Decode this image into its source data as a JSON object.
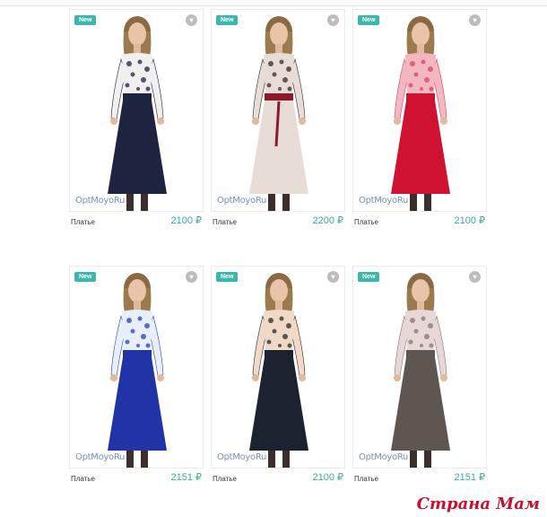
{
  "products": [
    {
      "badge": "New",
      "brand": "OptMoyoRu",
      "name": "Платье",
      "price": "2100 ₽",
      "colors": {
        "top": "#f0f0f0",
        "pattern": "#1e2340",
        "skirt": "#1e2340",
        "belt": "#1e2340"
      }
    },
    {
      "badge": "New",
      "brand": "OptMoyoRu",
      "name": "Платье",
      "price": "2200 ₽",
      "colors": {
        "top": "#e8ddd6",
        "pattern": "#3a2a2a",
        "skirt": "#e8ddd6",
        "belt": "#8b1a2f"
      }
    },
    {
      "badge": "New",
      "brand": "OptMoyoRu",
      "name": "Платье",
      "price": "2100 ₽",
      "colors": {
        "top": "#f3b7c2",
        "pattern": "#d6475f",
        "skirt": "#cf1232",
        "belt": "#cf1232"
      }
    },
    {
      "badge": "New",
      "brand": "OptMoyoRu",
      "name": "Платье",
      "price": "2151 ₽",
      "colors": {
        "top": "#e9eefb",
        "pattern": "#2742b8",
        "skirt": "#2233a6",
        "belt": "#2233a6"
      }
    },
    {
      "badge": "New",
      "brand": "OptMoyoRu",
      "name": "Платье",
      "price": "2100 ₽",
      "colors": {
        "top": "#f0d9c6",
        "pattern": "#2a2a2a",
        "skirt": "#1d2230",
        "belt": "#1d2230"
      }
    },
    {
      "badge": "New",
      "brand": "OptMoyoRu",
      "name": "Платье",
      "price": "2151 ₽",
      "colors": {
        "top": "#e7d7d7",
        "pattern": "#8a7272",
        "skirt": "#5e5650",
        "belt": "#5e5650"
      }
    }
  ],
  "watermark": "Страна Мам",
  "icons": {
    "favorite": "heart-icon"
  }
}
